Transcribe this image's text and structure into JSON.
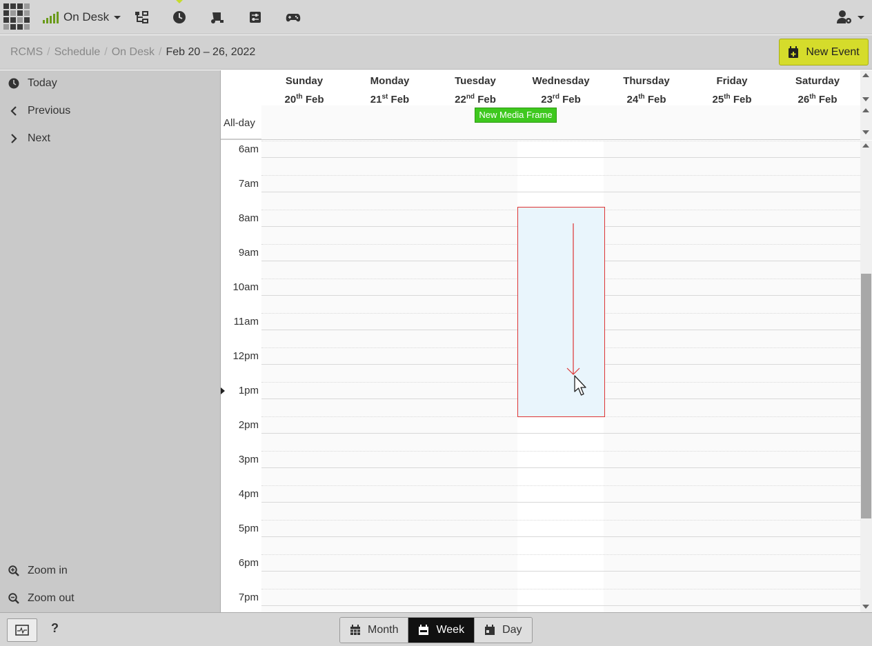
{
  "topbar": {
    "channel_label": "On Desk",
    "icons": [
      "apps-grid-icon",
      "signal-icon",
      "sitemap-icon",
      "clock-icon",
      "scroll-icon",
      "sliders-icon",
      "gamepad-icon",
      "user-cog-icon"
    ]
  },
  "breadcrumb": {
    "items": [
      "RCMS",
      "Schedule",
      "On Desk"
    ],
    "current": "Feb 20 – 26, 2022"
  },
  "new_event_label": "New Event",
  "sidebar": {
    "today": "Today",
    "previous": "Previous",
    "next": "Next",
    "zoom_in": "Zoom in",
    "zoom_out": "Zoom out"
  },
  "calendar": {
    "days": [
      {
        "name": "Sunday",
        "num": "20",
        "suffix": "th",
        "month": "Feb"
      },
      {
        "name": "Monday",
        "num": "21",
        "suffix": "st",
        "month": "Feb"
      },
      {
        "name": "Tuesday",
        "num": "22",
        "suffix": "nd",
        "month": "Feb"
      },
      {
        "name": "Wednesday",
        "num": "23",
        "suffix": "rd",
        "month": "Feb"
      },
      {
        "name": "Thursday",
        "num": "24",
        "suffix": "th",
        "month": "Feb"
      },
      {
        "name": "Friday",
        "num": "25",
        "suffix": "th",
        "month": "Feb"
      },
      {
        "name": "Saturday",
        "num": "26",
        "suffix": "th",
        "month": "Feb"
      }
    ],
    "allday_label": "All-day",
    "allday_event": {
      "title": "New Media Frame",
      "day": "Tuesday",
      "color": "#3ec81e"
    },
    "hours": [
      "6am",
      "7am",
      "8am",
      "9am",
      "10am",
      "11am",
      "12pm",
      "1pm",
      "2pm",
      "3pm",
      "4pm",
      "5pm",
      "6pm",
      "7pm"
    ],
    "selection": {
      "day": "Wednesday",
      "start": "8am",
      "end": "2pm"
    },
    "now": "1pm"
  },
  "views": {
    "month": "Month",
    "week": "Week",
    "day": "Day",
    "active": "week"
  },
  "help_label": "?",
  "colors": {
    "accent": "#d5dc2b",
    "event": "#3ec81e",
    "selection_border": "#d33333",
    "selection_fill": "#e9f5fc"
  }
}
